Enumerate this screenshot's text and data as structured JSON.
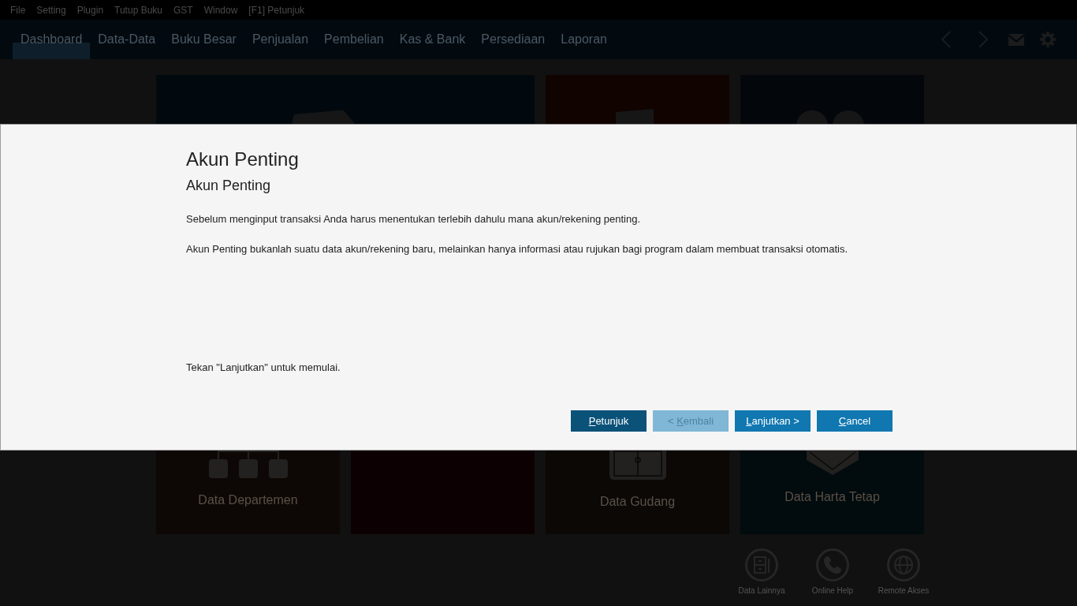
{
  "menu_bar": {
    "items": [
      "File",
      "Setting",
      "Plugin",
      "Tutup Buku",
      "GST",
      "Window",
      "[F1] Petunjuk"
    ]
  },
  "nav_bar": {
    "tabs": [
      {
        "label": "Dashboard",
        "selected": true
      },
      {
        "label": "Data-Data",
        "selected": false
      },
      {
        "label": "Buku Besar",
        "selected": false
      },
      {
        "label": "Penjualan",
        "selected": false
      },
      {
        "label": "Pembelian",
        "selected": false
      },
      {
        "label": "Kas & Bank",
        "selected": false
      },
      {
        "label": "Persediaan",
        "selected": false
      },
      {
        "label": "Laporan",
        "selected": false
      }
    ]
  },
  "tiles_top": [
    {
      "color": "#02090e",
      "wide": true
    },
    {
      "color": "#100300",
      "wide": false
    },
    {
      "color": "#03060b",
      "wide": false
    }
  ],
  "dialog": {
    "title": "Akun Penting",
    "subtitle": "Akun Penting",
    "paragraphs": [
      "Sebelum menginput transaksi Anda harus menentukan terlebih dahulu mana akun/rekening penting.",
      "Akun Penting bukanlah suatu data akun/rekening baru, melainkan hanya informasi atau rujukan bagi program dalam membuat transaksi otomatis."
    ],
    "hint": "Tekan \"Lanjutkan\" untuk memulai.",
    "buttons": [
      {
        "label": "Petunjuk",
        "focused": true,
        "disabled": false
      },
      {
        "label": "< Kembali",
        "focused": false,
        "disabled": true
      },
      {
        "label": "Lanjutkan >",
        "focused": false,
        "disabled": false
      },
      {
        "label": "Cancel",
        "focused": false,
        "disabled": false
      }
    ]
  },
  "tiles_bottom": [
    {
      "label": "Data Departemen",
      "color": "#0d0805"
    },
    {
      "color": "#0d0002"
    },
    {
      "label": "Data Gudang",
      "color": "#0b0805"
    },
    {
      "label": "Data Harta Tetap",
      "color": "#020b0d"
    }
  ],
  "shortcuts": [
    {
      "label": "Data Lainnya"
    },
    {
      "label": "Online Help"
    },
    {
      "label": "Remote Akses"
    }
  ]
}
